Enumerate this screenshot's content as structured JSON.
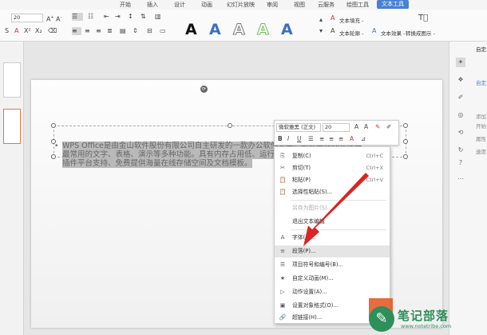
{
  "tabs": [
    "开始",
    "插入",
    "设计",
    "动画",
    "幻灯片放映",
    "审阅",
    "视图",
    "云服务",
    "绘图工具",
    "文本工具"
  ],
  "active_tab": "文本工具",
  "ribbon": {
    "font_size": "20",
    "text_fill": "文本填充 -",
    "text_outline": "文本轮廓 -",
    "text_effect": "文本效果 -",
    "convert_smartart": "转换成图示 -",
    "style_letter": "A"
  },
  "slide_text": {
    "line1": "WPS Office是由金山软件股份有限公司自主研发的一款办公软件套装，可以实现办公软件",
    "line2": "最常用的文字、表格、演示等多种功能。具有内存占用低、运行速度快、体积小巧、强大",
    "line3": "插件平台支持、免费提供海量在线存储空间及文档模板。"
  },
  "mini_toolbar": {
    "font_name": "微软雅黑 (正文)",
    "font_size": "20"
  },
  "context_menu": [
    {
      "icon": "⎘",
      "label": "复制(C)",
      "shortcut": "Ctrl+C",
      "disabled": false
    },
    {
      "icon": "✂",
      "label": "剪切(T)",
      "shortcut": "Ctrl+X",
      "disabled": false
    },
    {
      "icon": "📋",
      "label": "粘贴(P)",
      "shortcut": "Ctrl+V",
      "disabled": false
    },
    {
      "icon": "📋",
      "label": "选择性粘贴(S)...",
      "shortcut": "",
      "disabled": false
    },
    {
      "icon": "",
      "label": "另存为图片(S)...",
      "shortcut": "",
      "disabled": true
    },
    {
      "icon": "",
      "label": "退出文本编辑",
      "shortcut": "",
      "disabled": false
    },
    {
      "icon": "A",
      "label": "字体(F)...",
      "shortcut": "",
      "disabled": false
    },
    {
      "icon": "≡",
      "label": "段落(P)...",
      "shortcut": "",
      "disabled": false
    },
    {
      "icon": "☰",
      "label": "项目符号和编号(B)...",
      "shortcut": "",
      "disabled": false
    },
    {
      "icon": "★",
      "label": "自定义动画(M)...",
      "shortcut": "",
      "disabled": false
    },
    {
      "icon": "▷",
      "label": "动作设置(A)...",
      "shortcut": "",
      "disabled": false
    },
    {
      "icon": "▣",
      "label": "设置对象格式(O)...",
      "shortcut": "",
      "disabled": false
    },
    {
      "icon": "🔗",
      "label": "超链接(H)...",
      "shortcut": "",
      "disabled": false
    }
  ],
  "right_panel": {
    "header": "自定",
    "labels": [
      "自定",
      "添加",
      "开始",
      "属性",
      "速度"
    ]
  },
  "watermark": {
    "title": "笔记部落",
    "url": "www.notetribe.com"
  },
  "colors": {
    "accent_blue": "#4a7fd1",
    "arrow_red": "#d92525",
    "watermark_green": "#2f8f5a",
    "style_A_blue": "#3a6fc4",
    "style_A_green": "#6ebc58"
  }
}
